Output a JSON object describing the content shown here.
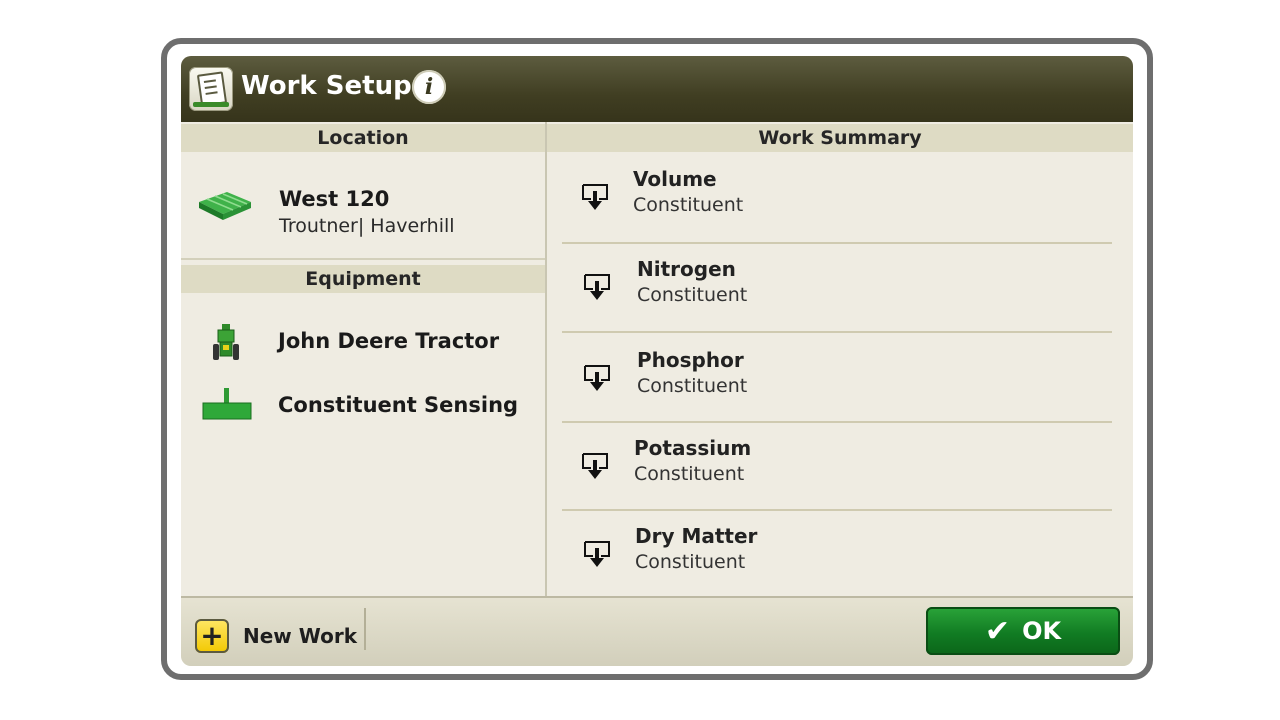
{
  "header": {
    "title": "Work Setup"
  },
  "location": {
    "heading": "Location",
    "name": "West 120",
    "sub": "Troutner| Haverhill"
  },
  "equipment": {
    "heading": "Equipment",
    "items": [
      {
        "label": "John Deere Tractor",
        "icon": "tractor-icon"
      },
      {
        "label": "Constituent Sensing",
        "icon": "implement-icon"
      }
    ]
  },
  "summary": {
    "heading": "Work Summary",
    "items": [
      {
        "name": "Volume",
        "type": "Constituent"
      },
      {
        "name": "Nitrogen",
        "type": "Constituent"
      },
      {
        "name": "Phosphor",
        "type": "Constituent"
      },
      {
        "name": "Potassium",
        "type": "Constituent"
      },
      {
        "name": "Dry Matter",
        "type": "Constituent"
      }
    ]
  },
  "footer": {
    "new_work_label": "New Work",
    "ok_label": "OK"
  },
  "colors": {
    "header": "#403e22",
    "panel": "#efece2",
    "accent_green": "#117c23",
    "add_yellow": "#f2c800"
  }
}
